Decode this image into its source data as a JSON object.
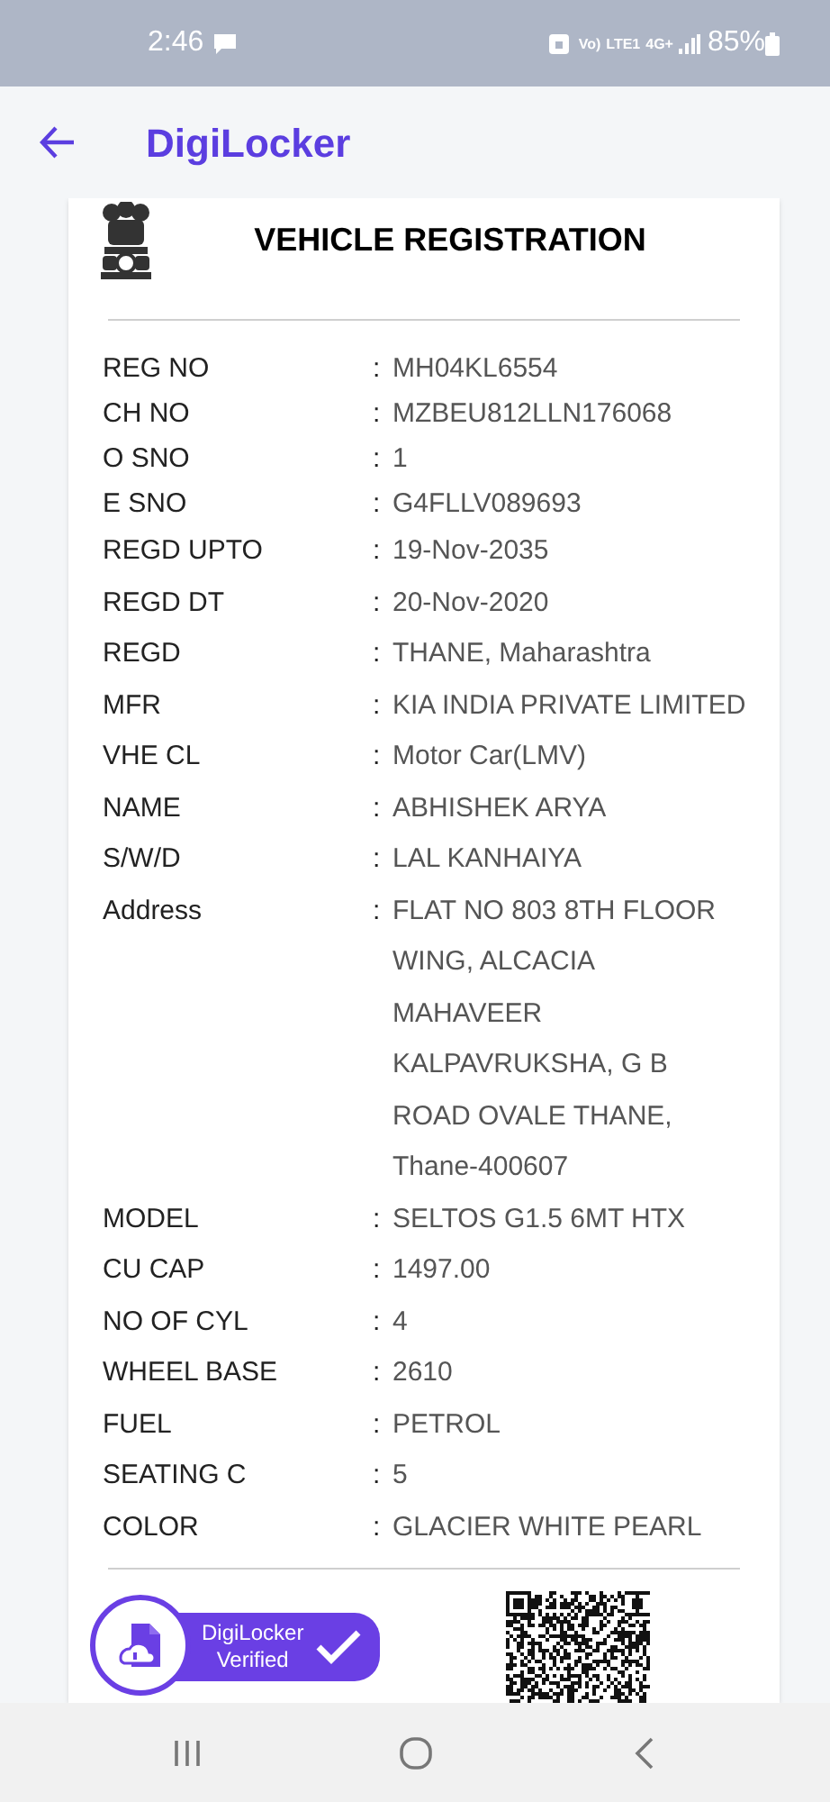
{
  "status_bar": {
    "time": "2:46",
    "network": [
      "Vo)",
      "LTE1",
      "4G+"
    ],
    "battery": "85%"
  },
  "app_bar": {
    "title": "DigiLocker"
  },
  "document": {
    "title": "VEHICLE REGISTRATION",
    "separator": ":",
    "rows": [
      {
        "label": "REG NO",
        "value": "MH04KL6554"
      },
      {
        "label": "CH NO",
        "value": "MZBEU812LLN176068"
      },
      {
        "label": "O SNO",
        "value": "1"
      },
      {
        "label": "E SNO",
        "value": "G4FLLV089693"
      },
      {
        "label": "REGD UPTO",
        "value": "19-Nov-2035"
      },
      {
        "label": "REGD DT",
        "value": "20-Nov-2020"
      },
      {
        "label": "REGD",
        "value": "THANE, Maharashtra"
      },
      {
        "label": "MFR",
        "value": "KIA INDIA PRIVATE LIMITED"
      },
      {
        "label": "VHE CL",
        "value": "Motor Car(LMV)"
      },
      {
        "label": "NAME",
        "value": "ABHISHEK ARYA"
      },
      {
        "label": "S/W/D",
        "value": "LAL KANHAIYA"
      },
      {
        "label": "Address",
        "value": "FLAT NO 803 8TH FLOOR WING, ALCACIA MAHAVEER KALPAVRUKSHA, G B ROAD OVALE THANE, Thane-400607"
      },
      {
        "label": "MODEL",
        "value": "SELTOS G1.5 6MT HTX"
      },
      {
        "label": "CU CAP",
        "value": "1497.00"
      },
      {
        "label": "NO OF CYL",
        "value": "4"
      },
      {
        "label": "WHEEL BASE",
        "value": "2610"
      },
      {
        "label": "FUEL",
        "value": "PETROL"
      },
      {
        "label": "SEATING C",
        "value": "5"
      },
      {
        "label": "COLOR",
        "value": "GLACIER WHITE PEARL"
      }
    ],
    "badge": [
      "DigiLocker",
      "Verified"
    ]
  }
}
